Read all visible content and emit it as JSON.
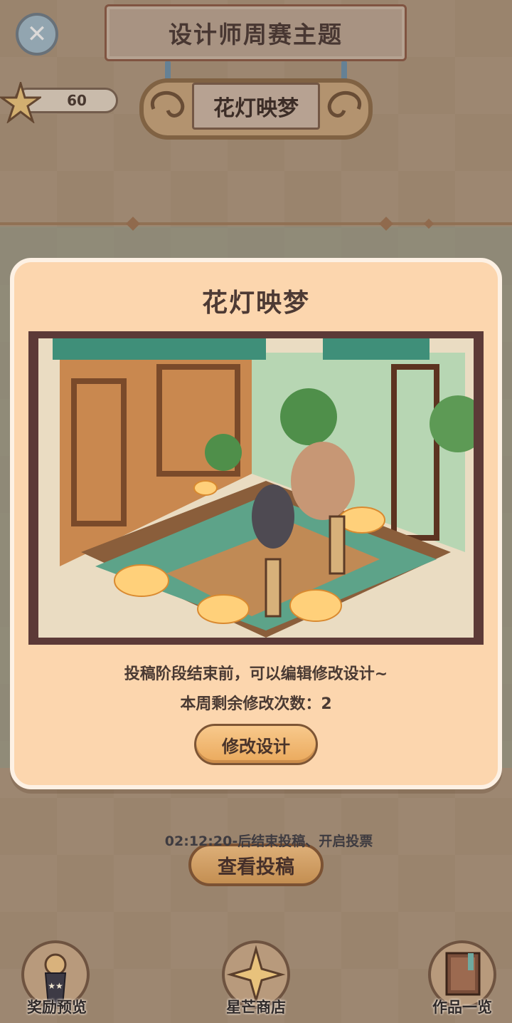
{
  "header": {
    "title": "设计师周赛主题",
    "theme_name": "花灯映梦",
    "star_count": "60",
    "close_icon": "close-icon",
    "star_icon": "star-icon"
  },
  "modal": {
    "title": "花灯映梦",
    "line1": "投稿阶段结束前，可以编辑修改设计~",
    "line2": "本周剩余修改次数：2",
    "edit_button": "修改设计"
  },
  "main": {
    "countdown": "02:12:20-后结束投稿、开启投票",
    "view_button": "查看投稿"
  },
  "bottom_nav": [
    {
      "label": "奖励预览",
      "icon": "trophy-icon"
    },
    {
      "label": "星芒商店",
      "icon": "star-shop-icon"
    },
    {
      "label": "作品一览",
      "icon": "book-icon"
    }
  ],
  "colors": {
    "modal_bg": "#fcd6ae",
    "button_accent": "#eaa95c",
    "text_dark": "#4a3a33"
  }
}
